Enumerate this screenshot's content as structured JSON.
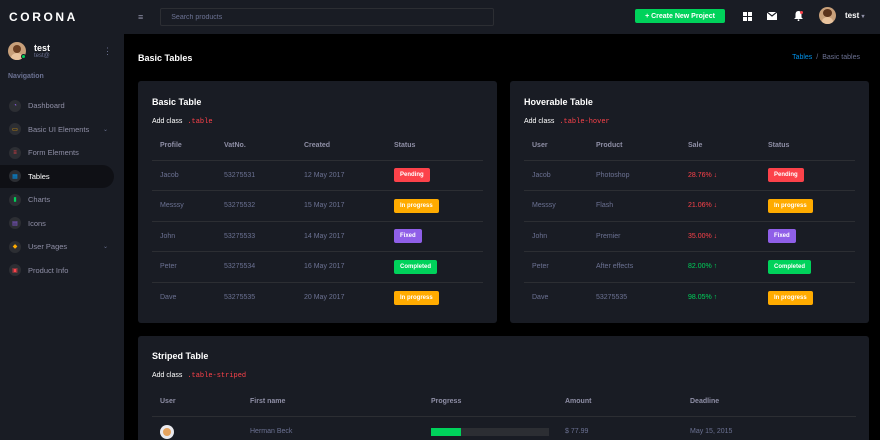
{
  "brand": "CORONA",
  "profile": {
    "name": "test",
    "sub": "test@"
  },
  "nav": {
    "title": "Navigation",
    "items": [
      {
        "label": "Dashboard",
        "icon": "speedometer-icon",
        "color": "#8f5fe8",
        "arrow": false
      },
      {
        "label": "Basic UI Elements",
        "icon": "laptop-icon",
        "color": "#ffab00",
        "arrow": true
      },
      {
        "label": "Form Elements",
        "icon": "playlist-icon",
        "color": "#fc424a",
        "arrow": false
      },
      {
        "label": "Tables",
        "icon": "table-icon",
        "color": "#0090e7",
        "arrow": false
      },
      {
        "label": "Charts",
        "icon": "chart-bar-icon",
        "color": "#00d25b",
        "arrow": false
      },
      {
        "label": "Icons",
        "icon": "contacts-icon",
        "color": "#8f5fe8",
        "arrow": false
      },
      {
        "label": "User Pages",
        "icon": "security-icon",
        "color": "#ffab00",
        "arrow": true
      },
      {
        "label": "Product Info",
        "icon": "file-document-icon",
        "color": "#fc424a",
        "arrow": false
      }
    ]
  },
  "topbar": {
    "search_placeholder": "Search products",
    "create_label": "+ Create New Project",
    "user": "test"
  },
  "page": {
    "title": "Basic Tables",
    "breadcrumb": {
      "link": "Tables",
      "sep": "/",
      "current": "Basic tables"
    }
  },
  "basic": {
    "title": "Basic Table",
    "desc": "Add class",
    "code": ".table",
    "headers": [
      "Profile",
      "VatNo.",
      "Created",
      "Status"
    ],
    "rows": [
      [
        "Jacob",
        "53275531",
        "12 May 2017",
        "Pending"
      ],
      [
        "Messsy",
        "53275532",
        "15 May 2017",
        "In progress"
      ],
      [
        "John",
        "53275533",
        "14 May 2017",
        "Fixed"
      ],
      [
        "Peter",
        "53275534",
        "16 May 2017",
        "Completed"
      ],
      [
        "Dave",
        "53275535",
        "20 May 2017",
        "In progress"
      ]
    ]
  },
  "hover": {
    "title": "Hoverable Table",
    "desc": "Add class",
    "code": ".table-hover",
    "headers": [
      "User",
      "Product",
      "Sale",
      "Status"
    ],
    "rows": [
      [
        "Jacob",
        "Photoshop",
        "28.76% ↓",
        "Pending"
      ],
      [
        "Messsy",
        "Flash",
        "21.06% ↓",
        "In progress"
      ],
      [
        "John",
        "Premier",
        "35.00% ↓",
        "Fixed"
      ],
      [
        "Peter",
        "After effects",
        "82.00% ↑",
        "Completed"
      ],
      [
        "Dave",
        "53275535",
        "98.05% ↑",
        "In progress"
      ]
    ]
  },
  "striped": {
    "title": "Striped Table",
    "desc": "Add class",
    "code": ".table-striped",
    "headers": [
      "User",
      "First name",
      "Progress",
      "Amount",
      "Deadline"
    ],
    "rows": [
      {
        "name": "Herman Beck",
        "progress": 0.25,
        "amount": "$ 77.99",
        "deadline": "May 15, 2015"
      }
    ]
  },
  "status_colors": {
    "Pending": "#fc424a",
    "In progress": "#ffab00",
    "Fixed": "#8f5fe8",
    "Completed": "#00d25b"
  }
}
